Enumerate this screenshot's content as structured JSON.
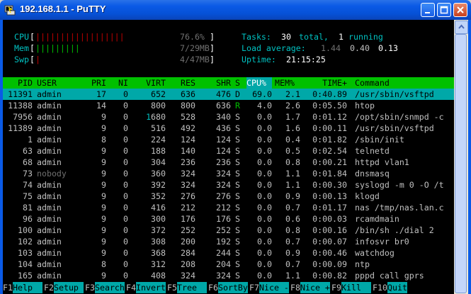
{
  "window": {
    "title": "192.168.1.1 - PuTTY",
    "icon": "putty-terminal-icon"
  },
  "meters": {
    "cpu": {
      "label": "CPU",
      "bars": "||||||||||||||||||",
      "value": "76.6%",
      "fraction": 0.766
    },
    "mem": {
      "label": "Mem",
      "bars": "|||||||||",
      "value": "7/29MB",
      "fraction": 0.24
    },
    "swp": {
      "label": "Swp",
      "bars": "|",
      "value": "4/47MB",
      "fraction": 0.085
    }
  },
  "summary": {
    "tasks_label": "Tasks:",
    "tasks_total": "30",
    "tasks_total_word": "total,",
    "tasks_running": "1",
    "tasks_running_word": "running",
    "load_label": "Load average:",
    "load_1": "1.44",
    "load_5": "0.40",
    "load_15": "0.13",
    "uptime_label": "Uptime:",
    "uptime": "21:15:25"
  },
  "columns": [
    "PID",
    "USER",
    "PRI",
    "NI",
    "VIRT",
    "RES",
    "SHR",
    "S",
    "CPU%",
    "MEM%",
    "TIME+",
    "Command"
  ],
  "processes": [
    {
      "pid": "11391",
      "user": "admin",
      "pri": "17",
      "ni": "0",
      "virt": "652",
      "res": "636",
      "shr": "476",
      "s": "D",
      "cpu": "69.0",
      "mem": "2.1",
      "time": "0:40.89",
      "cmd": "/usr/sbin/vsftpd"
    },
    {
      "pid": "11388",
      "user": "admin",
      "pri": "14",
      "ni": "0",
      "virt": "800",
      "res": "800",
      "shr": "636",
      "s": "R",
      "cpu": "4.0",
      "mem": "2.6",
      "time": "0:05.50",
      "cmd": "htop"
    },
    {
      "pid": "7956",
      "user": "admin",
      "pri": "9",
      "ni": "0",
      "virt": "1680",
      "res": "528",
      "shr": "340",
      "s": "S",
      "cpu": "0.0",
      "mem": "1.7",
      "time": "0:01.12",
      "cmd": "/opt/sbin/snmpd -c"
    },
    {
      "pid": "11389",
      "user": "admin",
      "pri": "9",
      "ni": "0",
      "virt": "516",
      "res": "492",
      "shr": "436",
      "s": "S",
      "cpu": "0.0",
      "mem": "1.6",
      "time": "0:00.11",
      "cmd": "/usr/sbin/vsftpd"
    },
    {
      "pid": "1",
      "user": "admin",
      "pri": "8",
      "ni": "0",
      "virt": "224",
      "res": "124",
      "shr": "124",
      "s": "S",
      "cpu": "0.0",
      "mem": "0.4",
      "time": "0:01.82",
      "cmd": "/sbin/init"
    },
    {
      "pid": "63",
      "user": "admin",
      "pri": "9",
      "ni": "0",
      "virt": "188",
      "res": "140",
      "shr": "124",
      "s": "S",
      "cpu": "0.0",
      "mem": "0.5",
      "time": "0:02.54",
      "cmd": "telnetd"
    },
    {
      "pid": "68",
      "user": "admin",
      "pri": "9",
      "ni": "0",
      "virt": "304",
      "res": "236",
      "shr": "236",
      "s": "S",
      "cpu": "0.0",
      "mem": "0.8",
      "time": "0:00.21",
      "cmd": "httpd vlan1"
    },
    {
      "pid": "73",
      "user": "nobody",
      "pri": "9",
      "ni": "0",
      "virt": "360",
      "res": "324",
      "shr": "324",
      "s": "S",
      "cpu": "0.0",
      "mem": "1.1",
      "time": "0:01.84",
      "cmd": "dnsmasq"
    },
    {
      "pid": "74",
      "user": "admin",
      "pri": "9",
      "ni": "0",
      "virt": "392",
      "res": "324",
      "shr": "324",
      "s": "S",
      "cpu": "0.0",
      "mem": "1.1",
      "time": "0:00.30",
      "cmd": "syslogd -m 0 -O /t"
    },
    {
      "pid": "75",
      "user": "admin",
      "pri": "9",
      "ni": "0",
      "virt": "352",
      "res": "276",
      "shr": "276",
      "s": "S",
      "cpu": "0.0",
      "mem": "0.9",
      "time": "0:00.13",
      "cmd": "klogd"
    },
    {
      "pid": "81",
      "user": "admin",
      "pri": "9",
      "ni": "0",
      "virt": "416",
      "res": "212",
      "shr": "212",
      "s": "S",
      "cpu": "0.0",
      "mem": "0.7",
      "time": "0:01.17",
      "cmd": "nas /tmp/nas.lan.c"
    },
    {
      "pid": "96",
      "user": "admin",
      "pri": "9",
      "ni": "0",
      "virt": "300",
      "res": "176",
      "shr": "176",
      "s": "S",
      "cpu": "0.0",
      "mem": "0.6",
      "time": "0:00.03",
      "cmd": "rcamdmain"
    },
    {
      "pid": "100",
      "user": "admin",
      "pri": "9",
      "ni": "0",
      "virt": "372",
      "res": "252",
      "shr": "252",
      "s": "S",
      "cpu": "0.0",
      "mem": "0.8",
      "time": "0:00.16",
      "cmd": "/bin/sh ./dial 2"
    },
    {
      "pid": "102",
      "user": "admin",
      "pri": "9",
      "ni": "0",
      "virt": "308",
      "res": "200",
      "shr": "192",
      "s": "S",
      "cpu": "0.0",
      "mem": "0.7",
      "time": "0:00.07",
      "cmd": "infosvr br0"
    },
    {
      "pid": "103",
      "user": "admin",
      "pri": "9",
      "ni": "0",
      "virt": "368",
      "res": "284",
      "shr": "244",
      "s": "S",
      "cpu": "0.0",
      "mem": "0.9",
      "time": "0:00.46",
      "cmd": "watchdog"
    },
    {
      "pid": "104",
      "user": "admin",
      "pri": "8",
      "ni": "0",
      "virt": "312",
      "res": "208",
      "shr": "204",
      "s": "S",
      "cpu": "0.0",
      "mem": "0.7",
      "time": "0:00.09",
      "cmd": "ntp"
    },
    {
      "pid": "165",
      "user": "admin",
      "pri": "9",
      "ni": "0",
      "virt": "408",
      "res": "324",
      "shr": "324",
      "s": "S",
      "cpu": "0.0",
      "mem": "1.1",
      "time": "0:00.82",
      "cmd": "pppd call gprs"
    }
  ],
  "footer": [
    {
      "key": "F1",
      "label": "Help  "
    },
    {
      "key": "F2",
      "label": "Setup "
    },
    {
      "key": "F3",
      "label": "Search"
    },
    {
      "key": "F4",
      "label": "Invert"
    },
    {
      "key": "F5",
      "label": "Tree  "
    },
    {
      "key": "F6",
      "label": "SortBy"
    },
    {
      "key": "F7",
      "label": "Nice -"
    },
    {
      "key": "F8",
      "label": "Nice +"
    },
    {
      "key": "F9",
      "label": "Kill  "
    },
    {
      "key": "F10",
      "label": "Quit"
    }
  ],
  "colors": {
    "header_bg": "#00c000",
    "selected_bg": "#00a8a8",
    "cyan": "#00c0c0",
    "green": "#00c000",
    "red": "#c00000",
    "titlebar": "#0a5ae6"
  }
}
